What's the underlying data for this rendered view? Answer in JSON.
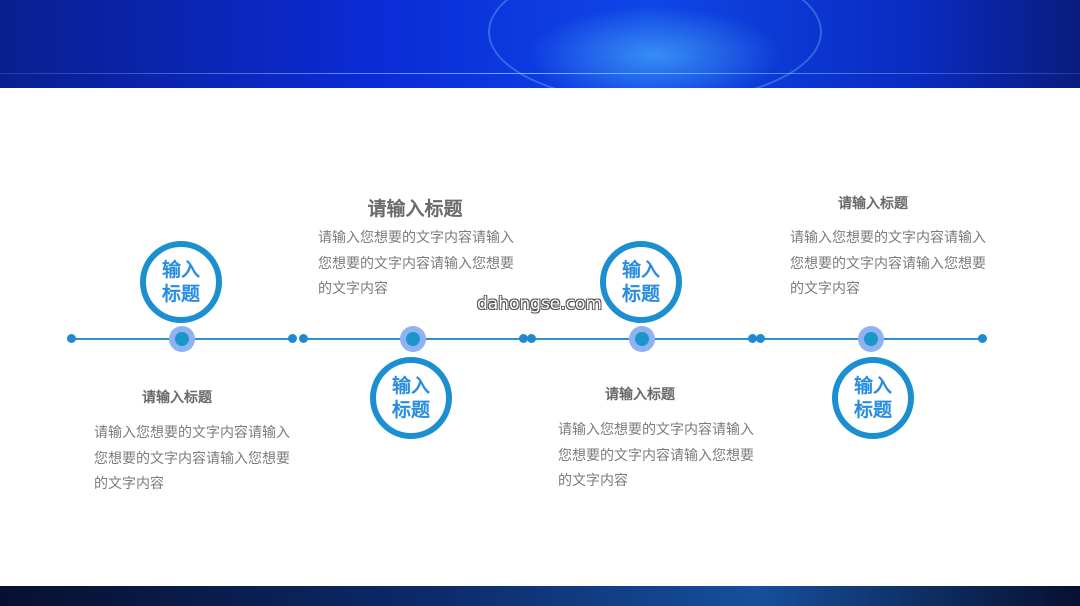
{
  "steps": [
    {
      "badge": "输入标题",
      "heading": "请输入标题",
      "body": "请输入您想要的文字内容请输入您想要的文字内容请输入您想要的文字内容"
    },
    {
      "badge": "输入标题",
      "heading": "请输入标题",
      "body": "请输入您想要的文字内容请输入您想要的文字内容请输入您想要的文字内容"
    },
    {
      "badge": "输入标题",
      "heading": "请输入标题",
      "body": "请输入您想要的文字内容请输入您想要的文字内容请输入您想要的文字内容"
    },
    {
      "badge": "输入标题",
      "heading": "请输入标题",
      "body": "请输入您想要的文字内容请输入您想要的文字内容请输入您想要的文字内容"
    }
  ],
  "watermark": "dahongse.com",
  "colors": {
    "accent": "#1c8fd0",
    "badge_text": "#2a8ee0",
    "banner": "#0b2bd6"
  }
}
